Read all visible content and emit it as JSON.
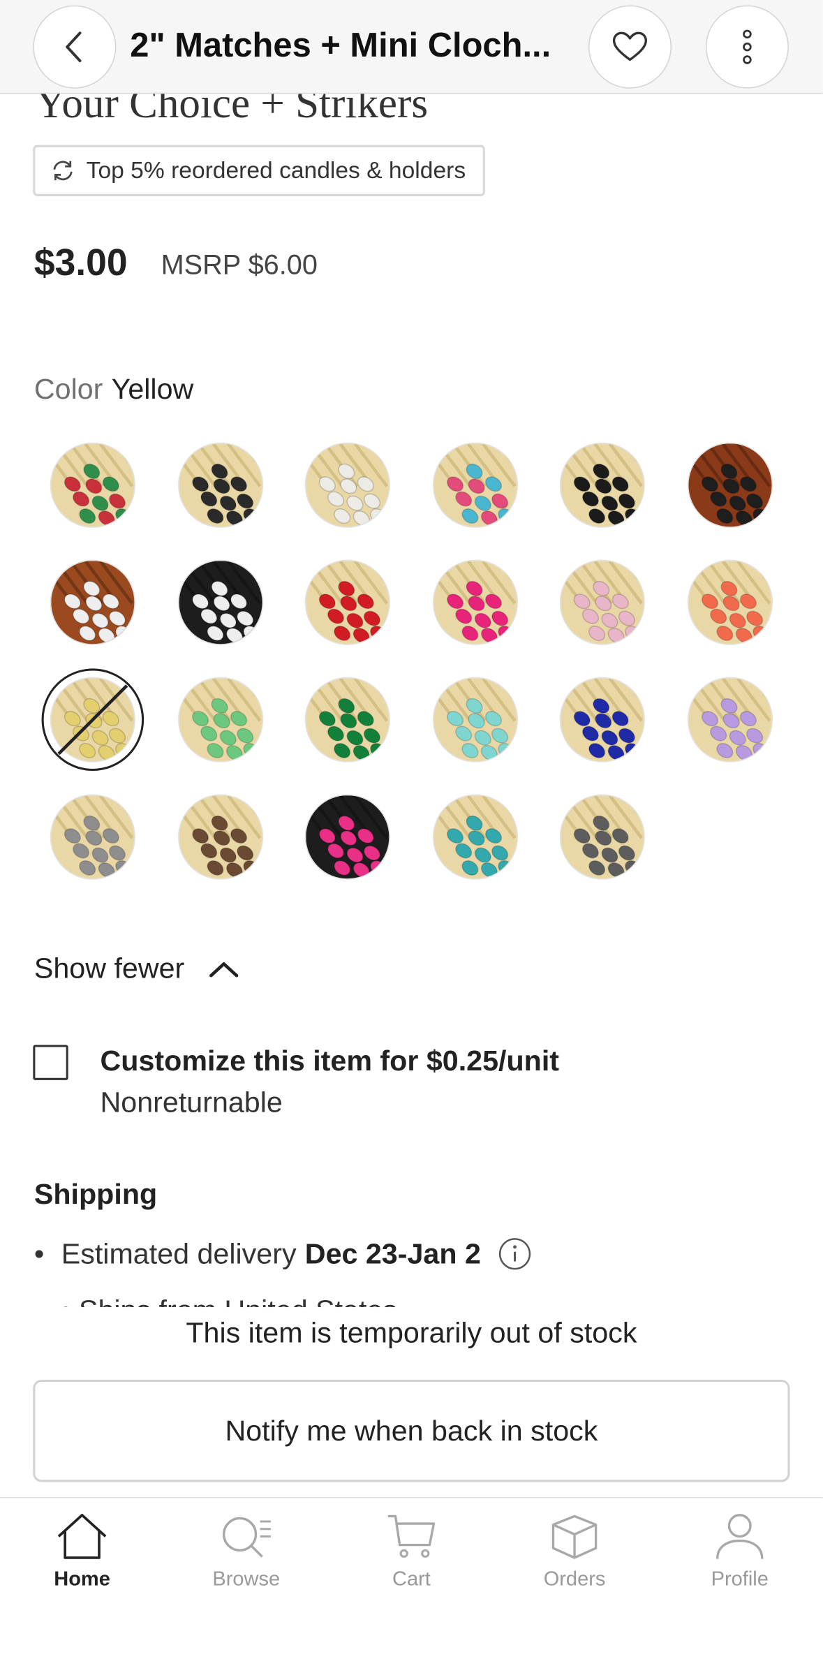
{
  "header": {
    "title": "2\" Matches + Mini Cloch...",
    "back_icon": "chevron-left-icon",
    "favorite_icon": "heart-icon",
    "more_icon": "more-vertical-icon"
  },
  "product": {
    "title_tail": "Your Choice + Strikers",
    "badge": "Top 5% reordered candles & holders",
    "price": "$3.00",
    "msrp": "MSRP $6.00"
  },
  "color": {
    "label": "Color",
    "selected": "Yellow",
    "swatches": [
      {
        "name": "mixed-red-green",
        "tone": "#c8303b",
        "alt": "#2f8f4a"
      },
      {
        "name": "black",
        "tone": "#2a2a2a"
      },
      {
        "name": "white",
        "tone": "#ecebe6"
      },
      {
        "name": "multicolor",
        "tone": "#e24b7a",
        "alt": "#4bb6d0"
      },
      {
        "name": "black-on-black",
        "tone": "#1b1b1b"
      },
      {
        "name": "black-on-brown",
        "tone": "#1e1e1e",
        "stick": "#8a3a18"
      },
      {
        "name": "white-on-brown",
        "tone": "#eeeeee",
        "stick": "#9a4a1e"
      },
      {
        "name": "white-on-black",
        "tone": "#eeeeee",
        "stick": "#1d1d1d"
      },
      {
        "name": "red",
        "tone": "#d11c24"
      },
      {
        "name": "pink",
        "tone": "#e8237a"
      },
      {
        "name": "light-pink",
        "tone": "#e8b6c8"
      },
      {
        "name": "coral",
        "tone": "#f26a4c"
      },
      {
        "name": "yellow",
        "tone": "#e4cf6e",
        "unavailable": true
      },
      {
        "name": "light-green",
        "tone": "#6cc77f"
      },
      {
        "name": "green",
        "tone": "#13803a"
      },
      {
        "name": "aqua",
        "tone": "#7fd6d0"
      },
      {
        "name": "navy",
        "tone": "#1f2ba6"
      },
      {
        "name": "lavender",
        "tone": "#b79ae0"
      },
      {
        "name": "gray",
        "tone": "#8e8e8e"
      },
      {
        "name": "brown",
        "tone": "#6b4a33"
      },
      {
        "name": "pink-on-black",
        "tone": "#ea2f86",
        "stick": "#1d1d1d"
      },
      {
        "name": "teal",
        "tone": "#33a9ad"
      },
      {
        "name": "dark-gray",
        "tone": "#5d5d5d"
      }
    ],
    "show_fewer": "Show fewer",
    "show_fewer_icon": "chevron-up-icon"
  },
  "customize": {
    "label": "Customize this item for $0.25/unit",
    "note": "Nonreturnable",
    "checked": false
  },
  "shipping": {
    "title": "Shipping",
    "delivery_prefix": "Estimated delivery",
    "delivery_dates": "Dec 23-Jan 2",
    "info_icon": "info-icon",
    "cut_line": "Ships from United States"
  },
  "stock": {
    "message": "This item is temporarily out of stock",
    "notify_button": "Notify me when back in stock"
  },
  "tabs": [
    {
      "label": "Home",
      "icon": "home-icon",
      "active": true
    },
    {
      "label": "Browse",
      "icon": "browse-icon",
      "active": false
    },
    {
      "label": "Cart",
      "icon": "cart-icon",
      "active": false
    },
    {
      "label": "Orders",
      "icon": "orders-icon",
      "active": false
    },
    {
      "label": "Profile",
      "icon": "profile-icon",
      "active": false
    }
  ]
}
